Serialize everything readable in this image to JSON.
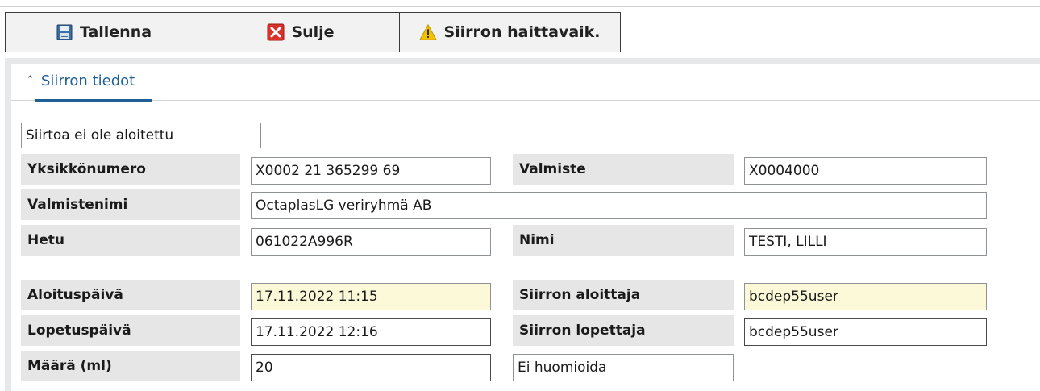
{
  "toolbar": {
    "save_label": "Tallenna",
    "close_label": "Sulje",
    "adverse_label": "Siirron haittavaik."
  },
  "section": {
    "title": "Siirron tiedot"
  },
  "form": {
    "status": "Siirtoa ei ole aloitettu",
    "unit_number_label": "Yksikkönumero",
    "unit_number": "X0002 21 365299 69",
    "product_label": "Valmiste",
    "product": "X0004000",
    "product_name_label": "Valmistenimi",
    "product_name": "OctaplasLG veriryhmä AB",
    "ssn_label": "Hetu",
    "ssn": "061022A996R",
    "name_label": "Nimi",
    "name": "TESTI, LILLI",
    "start_date_label": "Aloituspäivä",
    "start_date": "17.11.2022 11:15",
    "started_by_label": "Siirron aloittaja",
    "started_by": "bcdep55user",
    "end_date_label": "Lopetuspäivä",
    "end_date": "17.11.2022 12:16",
    "ended_by_label": "Siirron lopettaja",
    "ended_by": "bcdep55user",
    "amount_label": "Määrä (ml)",
    "amount": "20",
    "ignore_value": "Ei huomioida"
  },
  "colors": {
    "accent": "#1f5f96",
    "label_bg": "#e6e6e6",
    "highlight_field": "#fbf9d8",
    "close_red": "#d9322a",
    "warning_yellow": "#f2c200"
  },
  "icons": [
    "save-icon",
    "close-icon",
    "warning-icon",
    "chevron-up-icon"
  ]
}
